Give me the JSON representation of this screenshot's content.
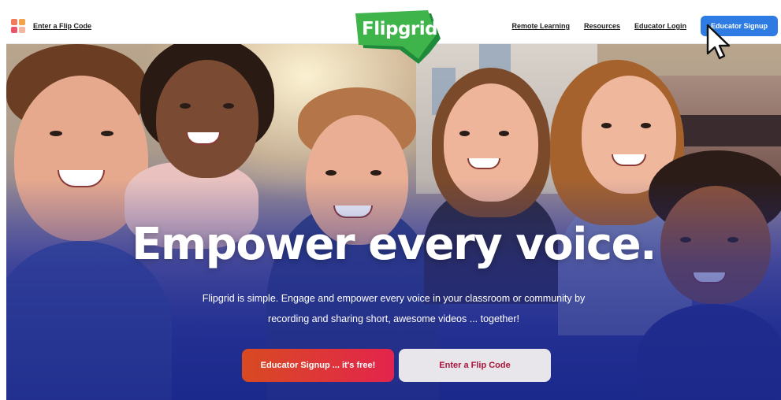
{
  "nav": {
    "flip_code_link": "Enter a Flip Code",
    "logo_text": "Flipgrid",
    "links": [
      "Remote Learning",
      "Resources",
      "Educator Login"
    ],
    "signup_label": "Educator Signup"
  },
  "hero": {
    "headline": "Empower every voice.",
    "subtext_line1": "Flipgrid is simple. Engage and empower every voice in your classroom or community by",
    "subtext_line2": "recording and sharing short, awesome videos ... together!",
    "cta_primary": "Educator Signup ... it's free!",
    "cta_secondary": "Enter a Flip Code"
  },
  "colors": {
    "brand_green": "#3fb44a",
    "signup_blue": "#2d7be3",
    "cta_gradient_start": "#d84a22",
    "cta_gradient_end": "#e3244c",
    "cta_secondary_text": "#a9143a"
  },
  "icons": [
    "apps-grid-icon",
    "flipgrid-logo",
    "mouse-pointer-icon"
  ]
}
